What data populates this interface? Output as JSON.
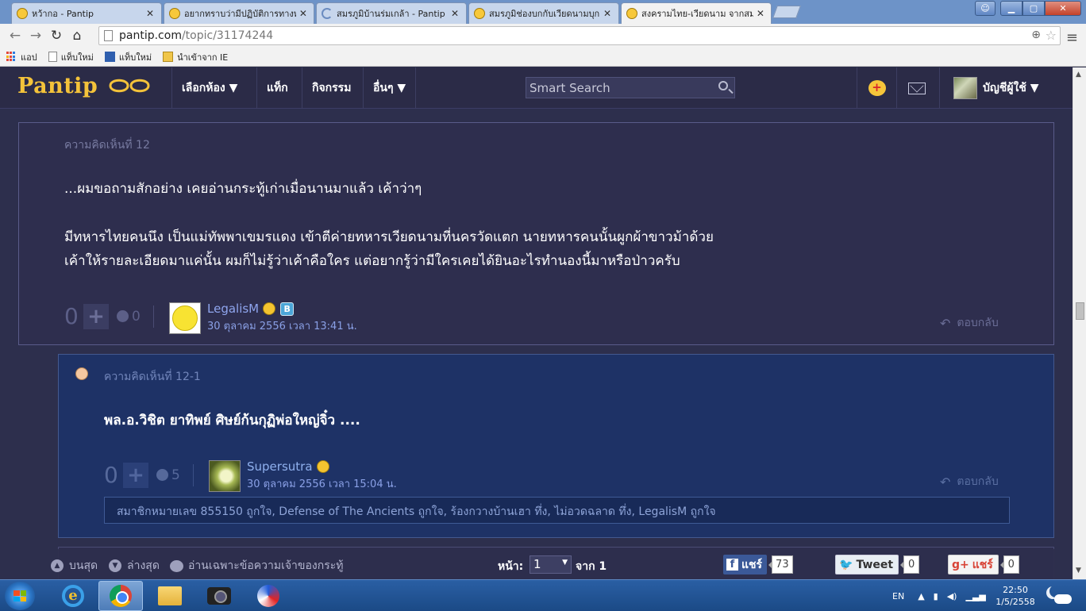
{
  "browser": {
    "tabs": [
      {
        "label": "หว้ากอ - Pantip",
        "favicon": "pantip-smiley-icon",
        "active": false
      },
      {
        "label": "อยากทราบว่ามีปฏิบัติการทางทหาร",
        "favicon": "pantip-smiley-icon",
        "active": false
      },
      {
        "label": "สมรภูมิบ้านร่มเกล้า - Pantip",
        "favicon": "loading-spinner-icon",
        "active": false
      },
      {
        "label": "สมรภูมิช่องบกกับเวียดนามบุก",
        "favicon": "pantip-smiley-icon",
        "active": false
      },
      {
        "label": "สงครามไทย-เวียดนาม จากสมรภูมิ",
        "favicon": "pantip-smiley-icon",
        "active": true
      }
    ],
    "url_host": "pantip.com",
    "url_path": "/topic/31174244",
    "bookmarks": [
      {
        "label": "แอป",
        "icon": "apps-grid-icon"
      },
      {
        "label": "แท็บใหม่",
        "icon": "page-icon"
      },
      {
        "label": "แท็บใหม่",
        "icon": "pantip-p-icon"
      },
      {
        "label": "นำเข้าจาก IE",
        "icon": "folder-icon"
      }
    ]
  },
  "header": {
    "logo_text": "Pantip",
    "nav": [
      {
        "label": "เลือกห้อง ▼"
      },
      {
        "label": "แท็ก"
      },
      {
        "label": "กิจกรรม"
      },
      {
        "label": "อื่นๆ ▼"
      }
    ],
    "search_placeholder": "Smart Search",
    "account_label": "บัญชีผู้ใช้ ▼"
  },
  "comments": [
    {
      "title": "ความคิดเห็นที่ 12",
      "body": [
        "...ผมขอถามสักอย่าง เคยอ่านกระทู้เก่าเมื่อนานมาแล้ว  เค้าว่าๆ",
        "",
        "มีทหารไทยคนนึง เป็นแม่ทัพพาเขมรแดง เข้าตีค่ายทหารเวียดนามที่นครวัดแตก นายทหารคนนั้นผูกผ้าขาวม้าด้วย",
        "เค้าให้รายละเอียดมาแค่นั้น ผมก็ไม่รู้ว่าเค้าคือใคร แต่อยากรู้ว่ามีใครเคยได้ยินอะไรทำนองนี้มาหรือป่าวครับ"
      ],
      "votes": "0",
      "emotions": "0",
      "author": "LegalisM",
      "date": "30 ตุลาคม 2556 เวลา 13:41 น.",
      "reply_label": "ตอบกลับ"
    },
    {
      "title": "ความคิดเห็นที่ 12-1",
      "body": [
        "พล.อ.วิชิต ยาทิพย์  ศิษย์ก้นกุฏิพ่อใหญ่จิ๋ว   ...."
      ],
      "votes": "0",
      "emotions": "5",
      "author": "Supersutra",
      "date": "30 ตุลาคม 2556 เวลา 15:04 น.",
      "reply_label": "ตอบกลับ",
      "reactions": "สมาชิกหมายเลข 855150 ถูกใจ, Defense of The Ancients ถูกใจ, ร้องกวางบ้านเฮา ทึ่ง, ไม่อวดฉลาด ทึ่ง, LegalisM ถูกใจ"
    }
  ],
  "bottom_bar": {
    "top_label": "บนสุด",
    "bottom_label": "ล่างสุด",
    "owner_only_label": "อ่านเฉพาะข้อความเจ้าของกระทู้",
    "page_label": "หน้า:",
    "page_value": "1",
    "of_label": "จาก 1",
    "fb_label": "แชร์",
    "fb_count": "73",
    "tweet_label": "Tweet",
    "tweet_count": "0",
    "gplus_label": "แชร์",
    "gplus_count": "0"
  },
  "taskbar": {
    "lang": "EN",
    "time": "22:50",
    "date": "1/5/2558"
  },
  "colors": {
    "pantip_gold": "#f4c33a",
    "page_bg": "#2d2f4d",
    "reply_bg": "#1e3266",
    "link_blue": "#8fa5ee"
  }
}
